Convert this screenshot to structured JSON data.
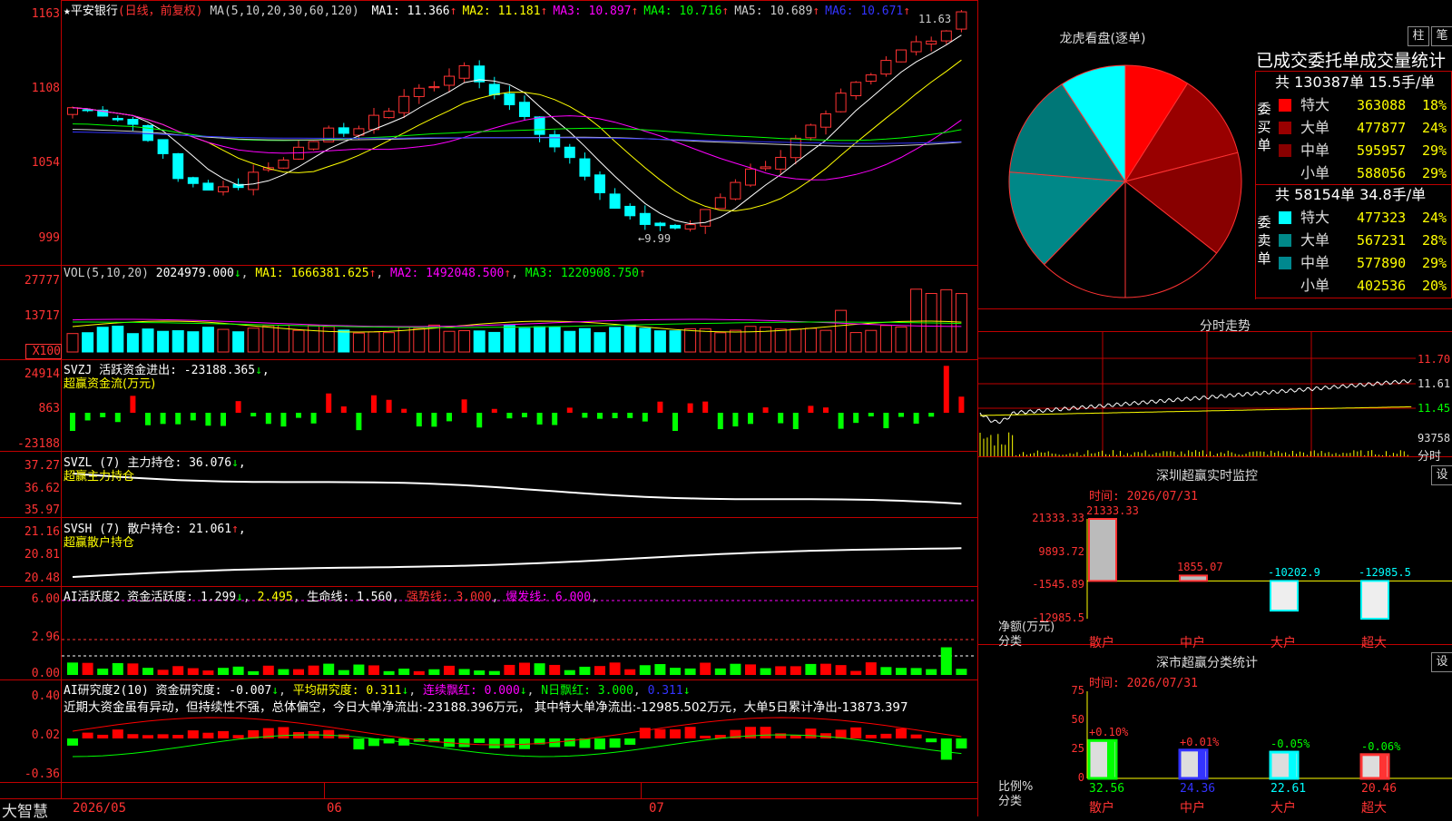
{
  "app": {
    "brand": "大智慧"
  },
  "stock": {
    "star": "★",
    "name": "平安银行",
    "mode": "(日线，前复权)"
  },
  "main_header": {
    "ma_def": "MA(5,10,20,30,60,120)",
    "items": [
      {
        "label": "MA1: 11.366",
        "arrow": "↑",
        "color": "#ffffff"
      },
      {
        "label": "MA2: 11.181",
        "arrow": "↑",
        "color": "#ffff00"
      },
      {
        "label": "MA3: 10.897",
        "arrow": "↑",
        "color": "#ff00ff"
      },
      {
        "label": "MA4: 10.716",
        "arrow": "↑",
        "color": "#00ff00"
      },
      {
        "label": "MA5: 10.689",
        "arrow": "↑",
        "color": "#cccccc"
      },
      {
        "label": "MA6: 10.671",
        "arrow": "↑",
        "color": "#3333ff"
      }
    ],
    "high_label": "11.63",
    "low_label": "←9.99"
  },
  "main_y": [
    "1163",
    "1108",
    "1054",
    "999"
  ],
  "vol_header": {
    "name": "VOL(5,10,20)",
    "value": "2024979.000",
    "ma1": "MA1: 1666381.625",
    "ma2": "MA2: 1492048.500",
    "ma3": "MA3: 1220908.750"
  },
  "vol_y": [
    "27777",
    "13717",
    "X100"
  ],
  "svzj": {
    "line1": "SVZJ  活跃资金进出: -23188.365",
    "line2": "超赢资金流(万元)",
    "y": [
      "24914",
      "863",
      "-23188"
    ]
  },
  "svzl": {
    "line1": "SVZL (7) 主力持仓: 36.076",
    "line2": "超赢主力持仓",
    "y": [
      "37.27",
      "36.62",
      "35.97"
    ]
  },
  "svsh": {
    "line1": "SVSH (7) 散户持仓: 21.061",
    "line2": "超赢散户持仓",
    "y": [
      "21.16",
      "20.81",
      "20.48"
    ]
  },
  "ai1": {
    "line1": "AI活跃度2 资金活跃度: 1.299",
    "v2": "2.495",
    "life": "生命线: 1.560",
    "strong": "强势线: 3.000",
    "burst": "爆发线: 6.000",
    "y": [
      "6.00",
      "2.96",
      "0.00"
    ]
  },
  "ai2": {
    "line1": "AI研究度2(10) 资金研究度: -0.007",
    "avg": "平均研究度: 0.311",
    "cont": "连续飘红: 0.000",
    "nday": "N日飘红: 3.000",
    "last": "0.311",
    "comment": "近期大资金虽有异动，但持续性不强，总体偏空，今日大单净流出:-23188.396万元， 其中特大单净流出:-12985.502万元，大单5日累计净出-13873.397",
    "y": [
      "0.40",
      "0.02",
      "-0.36"
    ]
  },
  "x_axis": [
    "2026/05",
    "06",
    "07"
  ],
  "lhb": {
    "title": "龙虎看盘(逐单)",
    "tabs": [
      "柱",
      "笔"
    ],
    "stats_title": "已成交委托单成交量统计",
    "buy": {
      "side": "委买单",
      "header": "共 130387单 15.5手/单",
      "rows": [
        {
          "name": "特大",
          "value": "363088",
          "pct": "18%",
          "color": "#ff0000"
        },
        {
          "name": "大单",
          "value": "477877",
          "pct": "24%",
          "color": "#990000"
        },
        {
          "name": "中单",
          "value": "595957",
          "pct": "29%",
          "color": "#880000"
        },
        {
          "name": "小单",
          "value": "588056",
          "pct": "29%",
          "color": "#000000"
        }
      ]
    },
    "sell": {
      "side": "委卖单",
      "header": "共 58154单 34.8手/单",
      "rows": [
        {
          "name": "特大",
          "value": "477323",
          "pct": "24%",
          "color": "#00ffff"
        },
        {
          "name": "大单",
          "value": "567231",
          "pct": "28%",
          "color": "#008888"
        },
        {
          "name": "中单",
          "value": "577890",
          "pct": "29%",
          "color": "#00888f"
        },
        {
          "name": "小单",
          "value": "402536",
          "pct": "20%",
          "color": "#000000"
        }
      ]
    }
  },
  "pie": [
    {
      "pct": 9.0,
      "color": "#ff0000"
    },
    {
      "pct": 12.0,
      "color": "#990000"
    },
    {
      "pct": 14.6,
      "color": "#880000"
    },
    {
      "pct": 14.4,
      "color": "#000000"
    },
    {
      "pct": 12.3,
      "color": "#000000"
    },
    {
      "pct": 14.0,
      "color": "#008888"
    },
    {
      "pct": 14.5,
      "color": "#007777"
    },
    {
      "pct": 9.2,
      "color": "#00ffff"
    }
  ],
  "fenshi": {
    "title": "分时走势",
    "y": [
      "11.70",
      "11.61",
      "11.45"
    ],
    "vol": "93758",
    "unit": "分时"
  },
  "monitor": {
    "title": "深圳超赢实时监控",
    "settings": "设",
    "time": "时间: 2026/07/31",
    "y": [
      "21333.33",
      "9893.72",
      "-1545.89",
      "-12985.5"
    ],
    "ylabel": "净额(万元)",
    "xlabel": "分类",
    "bars": [
      {
        "cat": "散户",
        "value": "21333.33"
      },
      {
        "cat": "中户",
        "value": "1855.07"
      },
      {
        "cat": "大户",
        "value": "-10202.9"
      },
      {
        "cat": "超大",
        "value": "-12985.5"
      }
    ]
  },
  "classify": {
    "title": "深市超赢分类统计",
    "settings": "设",
    "time": "时间: 2026/07/31",
    "y": [
      "75",
      "50",
      "25",
      "0"
    ],
    "ylabel": "比例%",
    "xlabel": "分类",
    "bars": [
      {
        "cat": "散户",
        "delta": "+0.10%",
        "value": "32.56",
        "color": "#00ff00"
      },
      {
        "cat": "中户",
        "delta": "+0.01%",
        "value": "24.36",
        "color": "#3333ff"
      },
      {
        "cat": "大户",
        "delta": "-0.05%",
        "value": "22.61",
        "color": "#00ffff"
      },
      {
        "cat": "超大",
        "delta": "-0.06%",
        "value": "20.46",
        "color": "#ff3333"
      }
    ]
  }
}
